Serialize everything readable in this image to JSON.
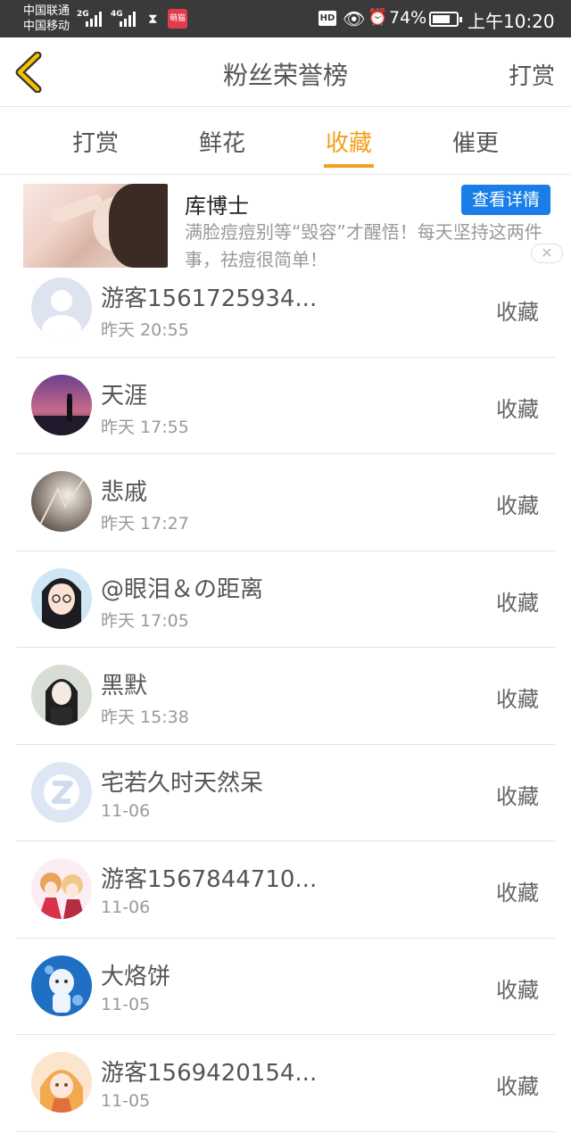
{
  "status_bar": {
    "carrier_1": "中国联通",
    "carrier_2": "中国移动",
    "net_1": "2G",
    "net_2": "4G",
    "app_icon_text": "萌猫",
    "hd": "HD",
    "battery": "74%",
    "battery_level": 0.74,
    "time": "上午10:20"
  },
  "header": {
    "title": "粉丝荣誉榜",
    "right_action": "打赏",
    "accent_color": "#f2a019"
  },
  "tabs": [
    {
      "label": "打赏"
    },
    {
      "label": "鲜花"
    },
    {
      "label": "收藏"
    },
    {
      "label": "催更"
    }
  ],
  "ad": {
    "title": "库博士",
    "button": "查看详情",
    "description": "满脸痘痘别等“毁容”才醒悟！每天坚持这两件事，祛痘很简单！",
    "close": "✕"
  },
  "fans": [
    {
      "name": "游客1561725934...",
      "time": "昨天 20:55",
      "action": "收藏"
    },
    {
      "name": "天涯",
      "time": "昨天 17:55",
      "action": "收藏"
    },
    {
      "name": "悲戚",
      "time": "昨天 17:27",
      "action": "收藏"
    },
    {
      "name": "@眼泪＆の距离",
      "time": "昨天 17:05",
      "action": "收藏"
    },
    {
      "name": "黑默",
      "time": "昨天 15:38",
      "action": "收藏"
    },
    {
      "name": "宅若久时天然呆",
      "time": "11-06",
      "action": "收藏"
    },
    {
      "name": "游客1567844710...",
      "time": "11-06",
      "action": "收藏"
    },
    {
      "name": "大烙饼",
      "time": "11-05",
      "action": "收藏"
    },
    {
      "name": "游客1569420154...",
      "time": "11-05",
      "action": "收藏"
    }
  ]
}
